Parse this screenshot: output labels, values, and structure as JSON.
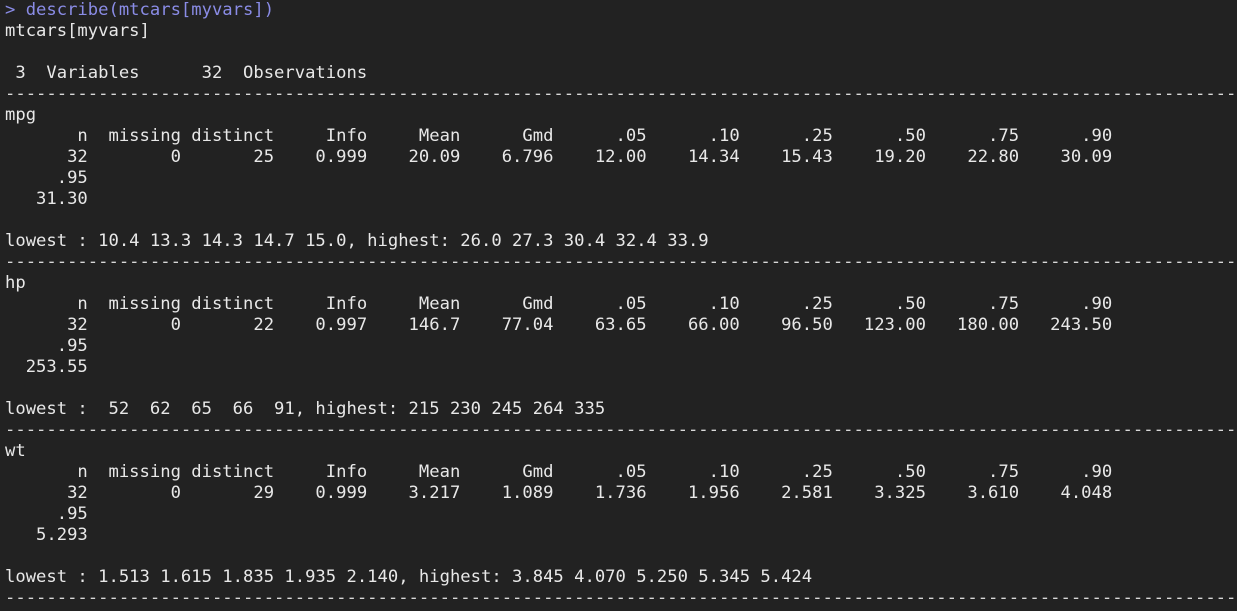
{
  "console": {
    "command": "> describe(mtcars[myvars])",
    "header_line": "mtcars[myvars]",
    "blank_1": "",
    "summary_line": " 3  Variables      32  Observations",
    "separator": "------------------------------------------------------------------------------------------------------------------------------------------------------------------",
    "variables": [
      {
        "name": "mpg",
        "header_row": "       n  missing distinct     Info     Mean      Gmd      .05      .10      .25      .50      .75      .90",
        "value_row": "      32        0       25    0.999    20.09    6.796    12.00    14.34    15.43    19.20    22.80    30.09",
        "extra_header": "     .95",
        "extra_value": "   31.30",
        "blank": "",
        "extremes": "lowest : 10.4 13.3 14.3 14.7 15.0, highest: 26.0 27.3 30.4 32.4 33.9"
      },
      {
        "name": "hp",
        "header_row": "       n  missing distinct     Info     Mean      Gmd      .05      .10      .25      .50      .75      .90",
        "value_row": "      32        0       22    0.997    146.7    77.04    63.65    66.00    96.50   123.00   180.00   243.50",
        "extra_header": "     .95",
        "extra_value": "  253.55",
        "blank": "",
        "extremes": "lowest :  52  62  65  66  91, highest: 215 230 245 264 335"
      },
      {
        "name": "wt",
        "header_row": "       n  missing distinct     Info     Mean      Gmd      .05      .10      .25      .50      .75      .90",
        "value_row": "      32        0       29    0.999    3.217    1.089    1.736    1.956    2.581    3.325    3.610    4.048",
        "extra_header": "     .95",
        "extra_value": "   5.293",
        "blank": "",
        "extremes": "lowest : 1.513 1.615 1.835 1.935 2.140, highest: 3.845 4.070 5.250 5.345 5.424"
      }
    ]
  },
  "colors": {
    "background": "#222222",
    "text": "#e8e8e8",
    "command": "#8a8ce6"
  }
}
